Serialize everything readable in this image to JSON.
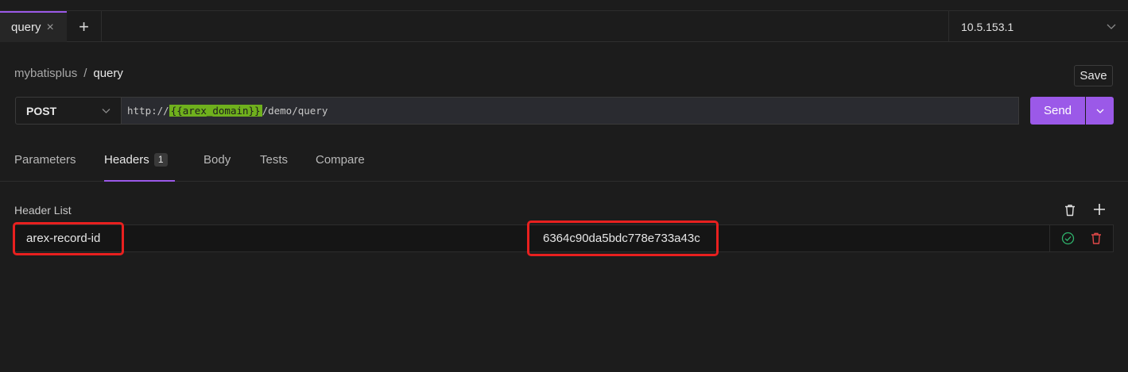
{
  "tabs": [
    {
      "label": "query",
      "close": "×"
    }
  ],
  "tab_add": "+",
  "environment": {
    "selected": "10.5.153.1"
  },
  "breadcrumb": {
    "parent": "mybatisplus",
    "separator": "/",
    "current": "query"
  },
  "save_label": "Save",
  "request": {
    "method": "POST",
    "url_prefix": "http://",
    "url_variable": "{{arex_domain}}",
    "url_suffix": "/demo/query",
    "send_label": "Send"
  },
  "request_tabs": [
    {
      "label": "Parameters"
    },
    {
      "label": "Headers",
      "badge": "1"
    },
    {
      "label": "Body"
    },
    {
      "label": "Tests"
    },
    {
      "label": "Compare"
    }
  ],
  "header_list": {
    "title": "Header List",
    "rows": [
      {
        "key": "arex-record-id",
        "value": "6364c90da5bdc778e733a43c"
      }
    ]
  },
  "colors": {
    "accent": "#9b59e8",
    "variable_highlight": "#6fb01d",
    "annotation_red": "#e8201f",
    "check_green": "#2fb36c",
    "delete_red": "#e04848"
  }
}
